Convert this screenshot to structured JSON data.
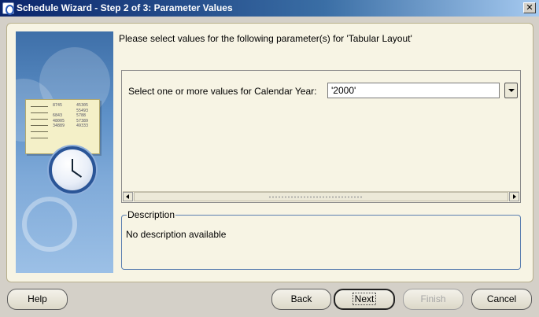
{
  "window": {
    "title": "Schedule Wizard - Step 2 of 3: Parameter Values",
    "close_glyph": "✕"
  },
  "main": {
    "prompt": "Please select values for the following parameter(s) for 'Tabular Layout'",
    "parameter": {
      "label": "Select one or more values for Calendar Year:",
      "value": "'2000'"
    },
    "description": {
      "legend": "Description",
      "text": "No description available"
    }
  },
  "illustration": {
    "nums_left": "8745\n\n6843\n48005\n34889",
    "nums_right": "45305\n55493\n5788\n57389\n49333"
  },
  "buttons": {
    "help": "Help",
    "back": "Back",
    "next": "Next",
    "finish": "Finish",
    "cancel": "Cancel"
  },
  "icons": {
    "title": "wizard-app-icon",
    "close": "close-icon",
    "dropdown": "chevron-down-icon",
    "scroll_left": "arrow-left-icon",
    "scroll_right": "arrow-right-icon",
    "illustration": "clock-schedule-illustration"
  }
}
